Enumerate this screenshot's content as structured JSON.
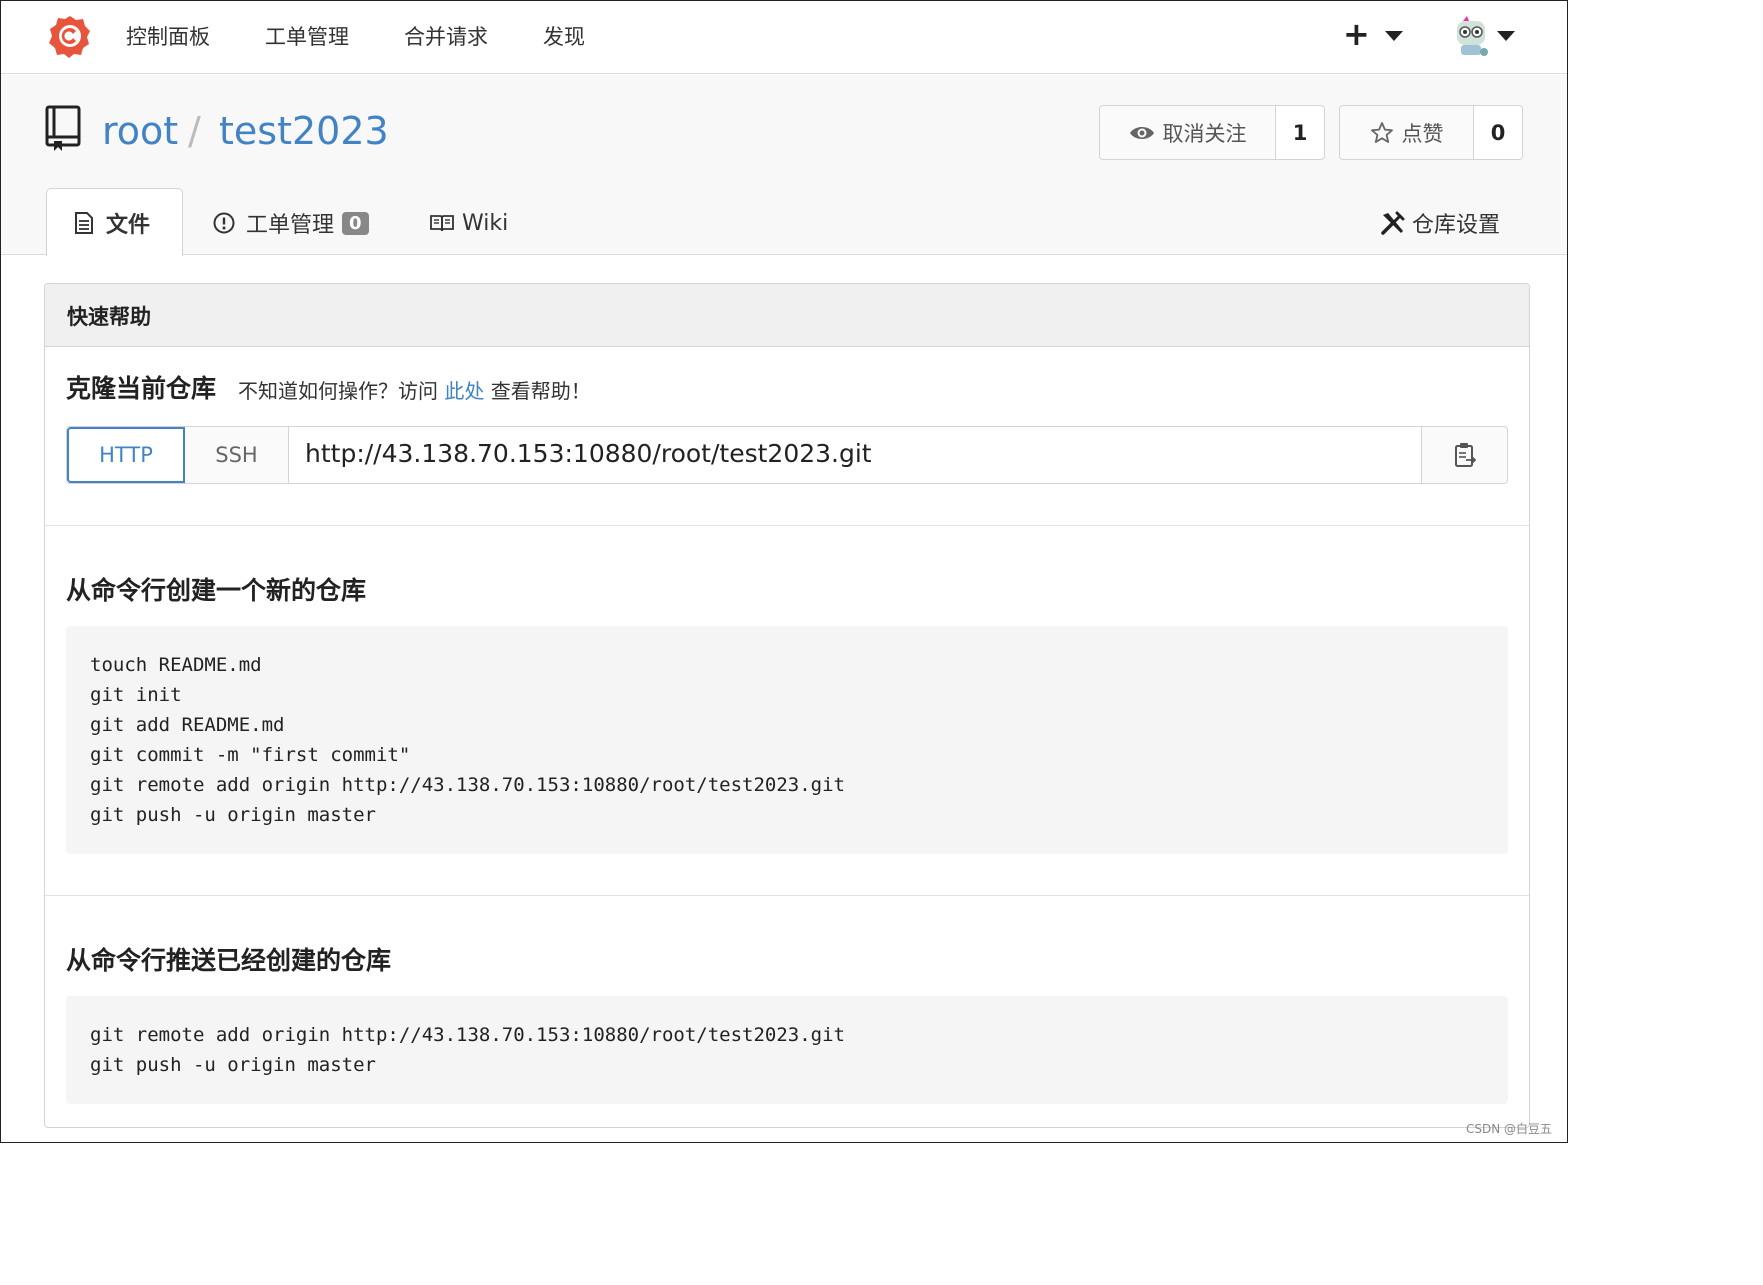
{
  "nav": {
    "items": [
      "控制面板",
      "工单管理",
      "合并请求",
      "发现"
    ],
    "plus_label": "+"
  },
  "repo": {
    "owner": "root",
    "separator": "/",
    "name": "test2023",
    "watch": {
      "label": "取消关注",
      "count": "1"
    },
    "star": {
      "label": "点赞",
      "count": "0"
    }
  },
  "tabs": {
    "files": "文件",
    "issues": "工单管理",
    "issues_count": "0",
    "wiki": "Wiki",
    "settings": "仓库设置"
  },
  "panel": {
    "title": "快速帮助",
    "clone_title": "克隆当前仓库",
    "clone_desc_before": "不知道如何操作？访问",
    "clone_desc_link": "此处",
    "clone_desc_after": "查看帮助！",
    "proto_http": "HTTP",
    "proto_ssh": "SSH",
    "clone_url": "http://43.138.70.153:10880/root/test2023.git",
    "new_repo_title": "从命令行创建一个新的仓库",
    "new_repo_code": [
      "touch README.md",
      "git init",
      "git add README.md",
      "git commit -m \"first commit\"",
      "git remote add origin http://43.138.70.153:10880/root/test2023.git",
      "git push -u origin master"
    ],
    "push_repo_title": "从命令行推送已经创建的仓库",
    "push_repo_code": [
      "git remote add origin http://43.138.70.153:10880/root/test2023.git",
      "git push -u origin master"
    ]
  },
  "watermark": "CSDN @白豆五",
  "colors": {
    "link": "#4183c4",
    "logo": "#e8553d"
  }
}
